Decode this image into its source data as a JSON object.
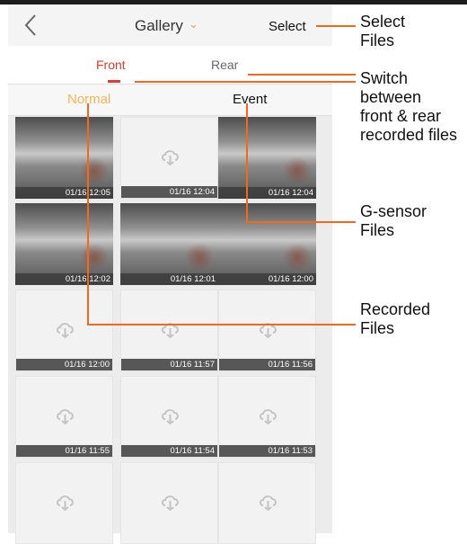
{
  "header": {
    "title": "Gallery",
    "caret": "⌄",
    "select_label": "Select",
    "back_icon": "chevron-left-icon"
  },
  "camera_tabs": [
    {
      "label": "Front",
      "active": true
    },
    {
      "label": "Rear",
      "active": false
    }
  ],
  "type_tabs": [
    {
      "label": "Normal",
      "active": true
    },
    {
      "label": "Event",
      "active": false
    }
  ],
  "colors": {
    "accent_red": "#e23b2b",
    "accent_orange": "#f5b552",
    "annotation_line": "#ef6a1e"
  },
  "thumbnails": [
    {
      "time": "01/16 12:05",
      "state": "video"
    },
    {
      "time": "01/16 12:04",
      "state": "cloud"
    },
    {
      "time": "01/16 12:04",
      "state": "video"
    },
    {
      "time": "01/16 12:02",
      "state": "video"
    },
    {
      "time": "01/16 12:01",
      "state": "video"
    },
    {
      "time": "01/16 12:00",
      "state": "video"
    },
    {
      "time": "01/16 12:00",
      "state": "cloud"
    },
    {
      "time": "01/16 11:57",
      "state": "cloud"
    },
    {
      "time": "01/16 11:56",
      "state": "cloud"
    },
    {
      "time": "01/16 11:55",
      "state": "cloud"
    },
    {
      "time": "01/16 11:54",
      "state": "cloud"
    },
    {
      "time": "01/16 11:53",
      "state": "cloud"
    },
    {
      "time": "",
      "state": "cloud"
    },
    {
      "time": "",
      "state": "cloud"
    },
    {
      "time": "",
      "state": "cloud"
    }
  ],
  "annotations": {
    "select_files": "Select\nFiles",
    "switch": "Switch\nbetween\nfront & rear\nrecorded files",
    "gsensor": "G-sensor\nFiles",
    "recorded": "Recorded\nFiles"
  }
}
